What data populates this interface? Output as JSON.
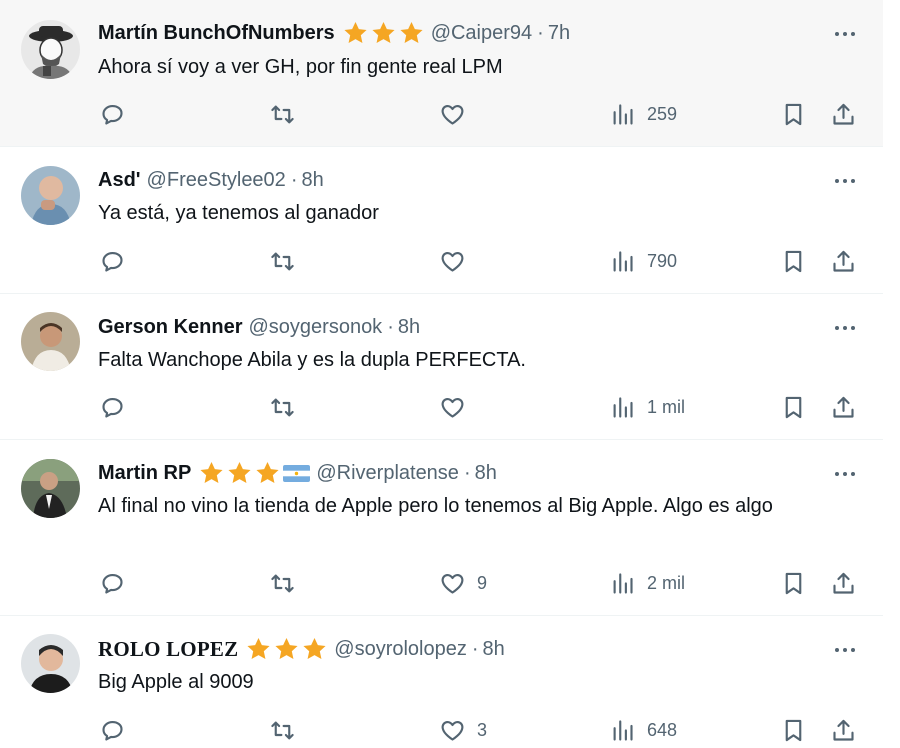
{
  "colors": {
    "star": "#f5a623",
    "muted": "#536471",
    "text": "#0f1419",
    "divider": "#eff3f4",
    "hover_bg": "#f7f7f7"
  },
  "icons": {
    "reply": "reply-icon",
    "retweet": "retweet-icon",
    "like": "heart-icon",
    "views": "views-icon",
    "bookmark": "bookmark-icon",
    "share": "share-icon",
    "more": "more-icon",
    "verified_star": "star-icon",
    "flag": "argentina-flag-icon"
  },
  "tweets": [
    {
      "name": "Martín BunchOfNumbers",
      "stars": 3,
      "flag": false,
      "handle": "@Caiper94",
      "separator": "·",
      "time": "7h",
      "text": "Ahora sí voy a ver GH, por fin gente real LPM",
      "replies": "",
      "retweets": "",
      "likes": "",
      "views": "259"
    },
    {
      "name": "Asd'",
      "stars": 0,
      "flag": false,
      "handle": "@FreeStylee02",
      "separator": "·",
      "time": "8h",
      "text": "Ya está, ya tenemos al ganador",
      "replies": "",
      "retweets": "",
      "likes": "",
      "views": "790"
    },
    {
      "name": "Gerson Kenner",
      "stars": 0,
      "flag": false,
      "handle": "@soygersonok",
      "separator": "·",
      "time": "8h",
      "text": "Falta Wanchope Abila y es la dupla PERFECTA.",
      "replies": "",
      "retweets": "",
      "likes": "",
      "views": "1 mil"
    },
    {
      "name": "Martin RP",
      "stars": 3,
      "flag": true,
      "handle": "@Riverplatense",
      "separator": "·",
      "time": "8h",
      "text": "Al final no vino la tienda de Apple pero lo tenemos al Big Apple. Algo es algo",
      "replies": "",
      "retweets": "",
      "likes": "9",
      "views": "2 mil"
    },
    {
      "name": "ROLO LOPEZ",
      "stars": 3,
      "flag": false,
      "handle": "@soyrololopez",
      "separator": "·",
      "time": "8h",
      "text": "Big Apple al 9009",
      "replies": "",
      "retweets": "",
      "likes": "3",
      "views": "648"
    }
  ]
}
